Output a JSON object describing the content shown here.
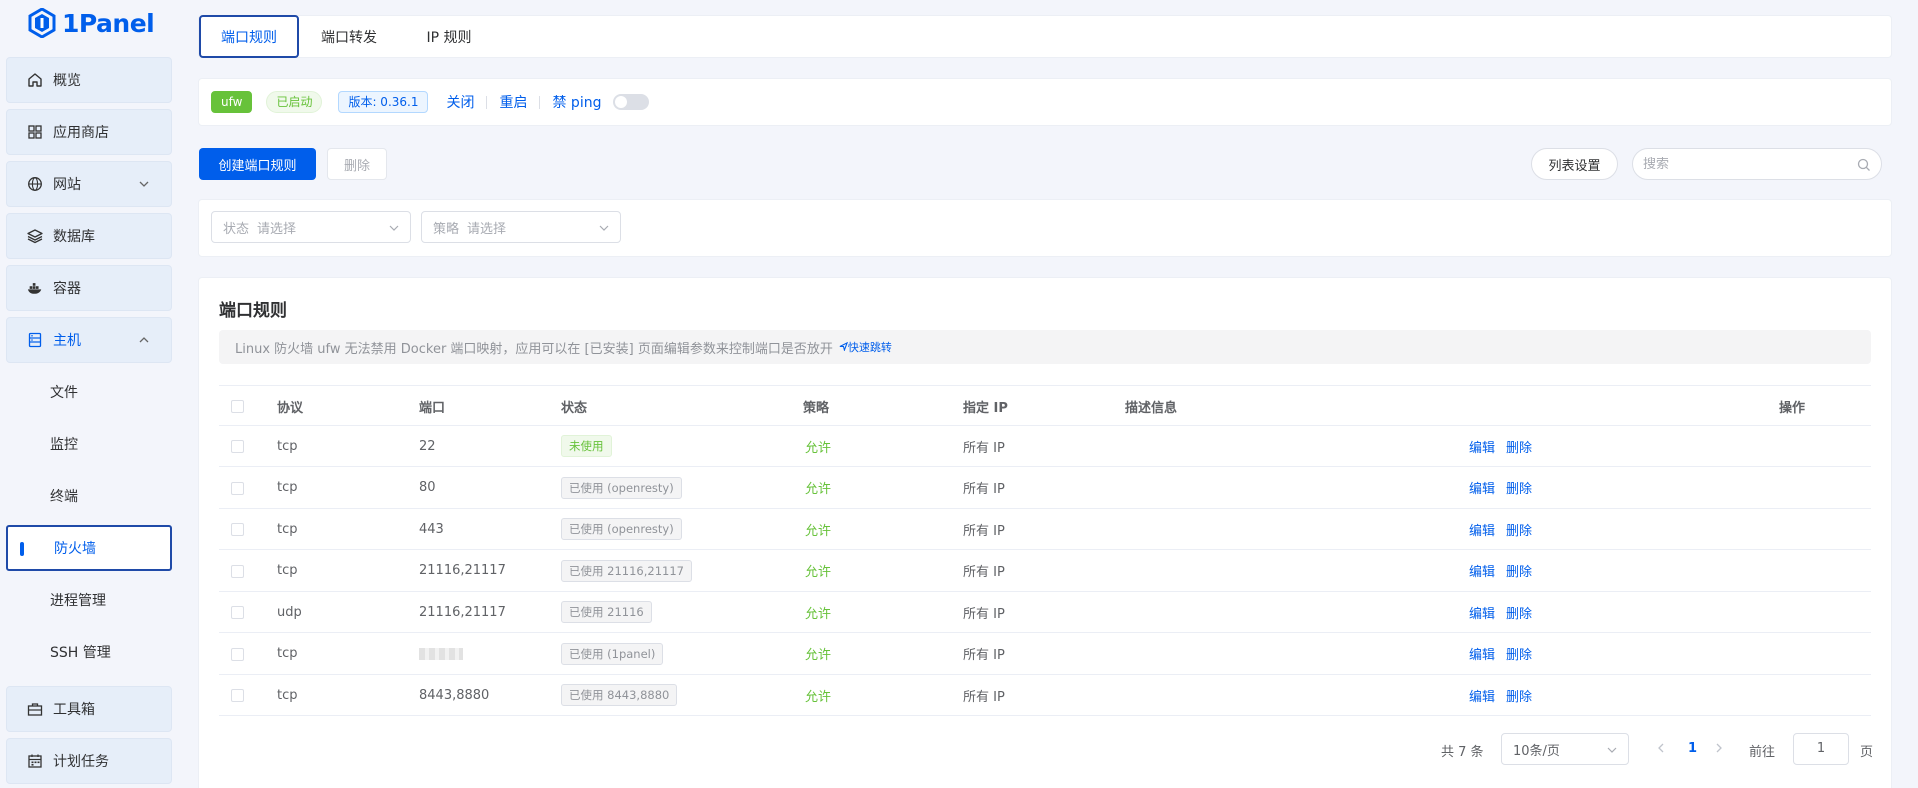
{
  "app": {
    "name": "1Panel"
  },
  "sidebar": {
    "items": [
      {
        "label": "概览",
        "icon": "home-icon"
      },
      {
        "label": "应用商店",
        "icon": "grid-icon"
      },
      {
        "label": "网站",
        "icon": "globe-icon"
      },
      {
        "label": "数据库",
        "icon": "layers-icon"
      },
      {
        "label": "容器",
        "icon": "docker-icon"
      },
      {
        "label": "主机",
        "icon": "server-icon"
      },
      {
        "label": "工具箱",
        "icon": "toolbox-icon"
      },
      {
        "label": "计划任务",
        "icon": "calendar-icon"
      }
    ],
    "host_sub": [
      {
        "label": "文件"
      },
      {
        "label": "监控"
      },
      {
        "label": "终端"
      },
      {
        "label": "防火墙"
      },
      {
        "label": "进程管理"
      },
      {
        "label": "SSH 管理"
      }
    ]
  },
  "tabs": [
    {
      "label": "端口规则"
    },
    {
      "label": "端口转发"
    },
    {
      "label": "IP 规则"
    }
  ],
  "status": {
    "engine": "ufw",
    "state": "已启动",
    "version": "版本: 0.36.1",
    "stop": "关闭",
    "restart": "重启",
    "ping_label": "禁 ping",
    "ping_enabled": false
  },
  "toolbar": {
    "create": "创建端口规则",
    "delete": "删除",
    "columns": "列表设置",
    "search_placeholder": "搜索"
  },
  "filters": {
    "status_label": "状态",
    "status_placeholder": "请选择",
    "strategy_label": "策略",
    "strategy_placeholder": "请选择"
  },
  "table": {
    "title": "端口规则",
    "notice": "Linux 防火墙 ufw 无法禁用 Docker 端口映射，应用可以在 [已安装] 页面编辑参数来控制端口是否放开",
    "notice_link": "快速跳转",
    "headers": [
      "协议",
      "端口",
      "状态",
      "策略",
      "指定 IP",
      "描述信息",
      "操作"
    ],
    "edit_label": "编辑",
    "delete_label": "删除",
    "rows": [
      {
        "protocol": "tcp",
        "port": "22",
        "status": "未使用",
        "unused": true,
        "strategy": "允许",
        "ip": "所有 IP",
        "desc": ""
      },
      {
        "protocol": "tcp",
        "port": "80",
        "status": "已使用 (openresty)",
        "unused": false,
        "strategy": "允许",
        "ip": "所有 IP",
        "desc": ""
      },
      {
        "protocol": "tcp",
        "port": "443",
        "status": "已使用 (openresty)",
        "unused": false,
        "strategy": "允许",
        "ip": "所有 IP",
        "desc": ""
      },
      {
        "protocol": "tcp",
        "port": "21116,21117",
        "status": "已使用 21116,21117",
        "unused": false,
        "strategy": "允许",
        "ip": "所有 IP",
        "desc": ""
      },
      {
        "protocol": "udp",
        "port": "21116,21117",
        "status": "已使用 21116",
        "unused": false,
        "strategy": "允许",
        "ip": "所有 IP",
        "desc": ""
      },
      {
        "protocol": "tcp",
        "port": "",
        "port_redacted": true,
        "status": "已使用 (1panel)",
        "unused": false,
        "strategy": "允许",
        "ip": "所有 IP",
        "desc": ""
      },
      {
        "protocol": "tcp",
        "port": "8443,8880",
        "status": "已使用 8443,8880",
        "unused": false,
        "strategy": "允许",
        "ip": "所有 IP",
        "desc": ""
      }
    ]
  },
  "pagination": {
    "total": "共 7 条",
    "page_size": "10条/页",
    "current": "1",
    "goto_label": "前往",
    "goto_value": "1",
    "page_suffix": "页"
  },
  "colors": {
    "primary": "#005eeb",
    "success": "#67c23a",
    "sidebar_bg": "#e6eef9"
  }
}
